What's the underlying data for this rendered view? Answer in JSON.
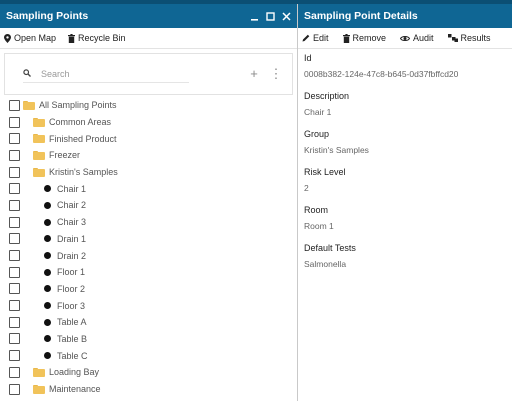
{
  "left": {
    "title": "Sampling Points",
    "toolbar": {
      "open_map": "Open Map",
      "recycle_bin": "Recycle Bin"
    },
    "search": {
      "placeholder": "Search",
      "add": "+",
      "more": "⋮"
    },
    "tree": [
      {
        "label": "All Sampling Points",
        "type": "folder",
        "level": 0
      },
      {
        "label": "Common Areas",
        "type": "folder",
        "level": 1
      },
      {
        "label": "Finished Product",
        "type": "folder",
        "level": 1
      },
      {
        "label": "Freezer",
        "type": "folder",
        "level": 1
      },
      {
        "label": "Kristin's Samples",
        "type": "folder",
        "level": 1
      },
      {
        "label": "Chair 1",
        "type": "point",
        "level": 2
      },
      {
        "label": "Chair 2",
        "type": "point",
        "level": 2
      },
      {
        "label": "Chair 3",
        "type": "point",
        "level": 2
      },
      {
        "label": "Drain 1",
        "type": "point",
        "level": 2
      },
      {
        "label": "Drain 2",
        "type": "point",
        "level": 2
      },
      {
        "label": "Floor 1",
        "type": "point",
        "level": 2
      },
      {
        "label": "Floor 2",
        "type": "point",
        "level": 2
      },
      {
        "label": "Floor 3",
        "type": "point",
        "level": 2
      },
      {
        "label": "Table A",
        "type": "point",
        "level": 2
      },
      {
        "label": "Table B",
        "type": "point",
        "level": 2
      },
      {
        "label": "Table C",
        "type": "point",
        "level": 2
      },
      {
        "label": "Loading Bay",
        "type": "folder",
        "level": 1
      },
      {
        "label": "Maintenance",
        "type": "folder",
        "level": 1
      }
    ]
  },
  "right": {
    "title": "Sampling Point Details",
    "toolbar": {
      "edit": "Edit",
      "remove": "Remove",
      "audit": "Audit",
      "results": "Results"
    },
    "fields": [
      {
        "label": "Id",
        "value": "0008b382-124e-47c8-b645-0d37fbffcd20"
      },
      {
        "label": "Description",
        "value": "Chair 1"
      },
      {
        "label": "Group",
        "value": "Kristin's Samples"
      },
      {
        "label": "Risk Level",
        "value": "2"
      },
      {
        "label": "Room",
        "value": "Room 1"
      },
      {
        "label": "Default Tests",
        "value": "Salmonella"
      }
    ]
  },
  "colors": {
    "titlebar": "#0f6694",
    "topstrip": "#0b4f74",
    "folder": "#f1c35a"
  }
}
